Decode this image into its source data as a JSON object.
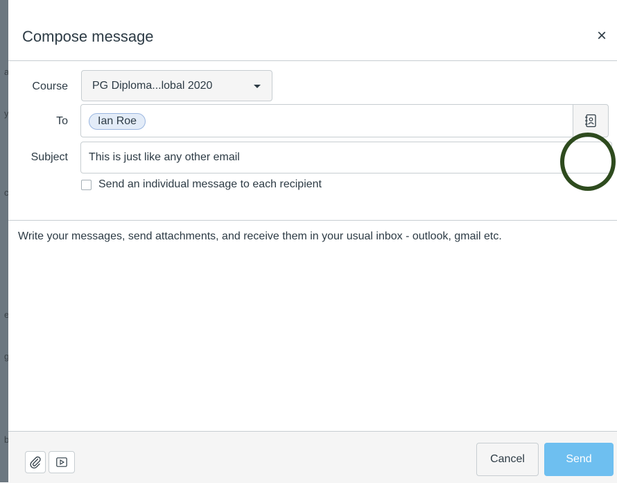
{
  "background_fragments": [
    "a",
    "y",
    "c",
    "e",
    "g",
    "b"
  ],
  "modal": {
    "title": "Compose message",
    "close_glyph": "×",
    "close_icon": "close-icon"
  },
  "form": {
    "course_label": "Course",
    "course_value": "PG Diploma...lobal 2020",
    "to_label": "To",
    "recipients": [
      "Ian Roe"
    ],
    "address_book_icon": "address-book-icon",
    "subject_label": "Subject",
    "subject_value": "This is just like any other email",
    "individual_checkbox_label": "Send an individual message to each recipient",
    "individual_checked": false
  },
  "message": {
    "body": "Write your messages, send attachments, and receive them in your usual inbox - outlook, gmail etc."
  },
  "footer": {
    "attach_icon": "paperclip-icon",
    "media_icon": "media-icon",
    "cancel_label": "Cancel",
    "send_label": "Send"
  },
  "colors": {
    "send_button": "#6ebff0",
    "annotation_circle": "#2e4b1e",
    "token_bg": "#e3ecf8"
  }
}
